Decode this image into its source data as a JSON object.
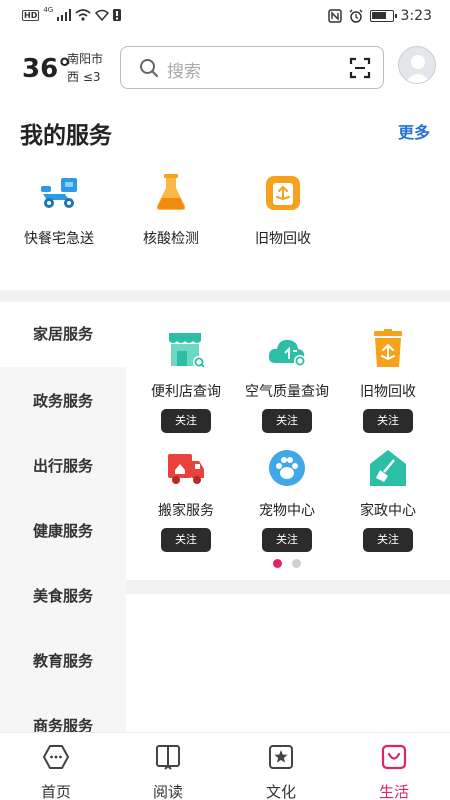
{
  "status_bar": {
    "network": "HD",
    "signal_type": "4G",
    "time": "3:23"
  },
  "header": {
    "temperature": "36°",
    "city": "南阳市",
    "wind": "西 ≤3",
    "search_placeholder": "搜索"
  },
  "my_services": {
    "title": "我的服务",
    "more": "更多",
    "items": [
      {
        "label": "快餐宅急送",
        "icon": "delivery-scooter-icon"
      },
      {
        "label": "核酸检测",
        "icon": "test-tube-icon"
      },
      {
        "label": "旧物回收",
        "icon": "recycle-bin-icon"
      }
    ]
  },
  "categories": [
    {
      "label": "家居服务",
      "active": true
    },
    {
      "label": "政务服务"
    },
    {
      "label": "出行服务"
    },
    {
      "label": "健康服务"
    },
    {
      "label": "美食服务"
    },
    {
      "label": "教育服务"
    },
    {
      "label": "商务服务"
    }
  ],
  "grid": {
    "follow_label": "关注",
    "items": [
      {
        "label": "便利店查询",
        "icon": "store-icon"
      },
      {
        "label": "空气质量查询",
        "icon": "air-cloud-icon"
      },
      {
        "label": "旧物回收",
        "icon": "recycle-bin-icon"
      },
      {
        "label": "搬家服务",
        "icon": "moving-truck-icon"
      },
      {
        "label": "宠物中心",
        "icon": "paw-icon"
      },
      {
        "label": "家政中心",
        "icon": "cleaning-house-icon"
      }
    ],
    "page_count": 2,
    "current_page": 1
  },
  "tabs": [
    {
      "label": "首页",
      "icon": "home-icon"
    },
    {
      "label": "阅读",
      "icon": "book-icon"
    },
    {
      "label": "文化",
      "icon": "culture-icon"
    },
    {
      "label": "生活",
      "icon": "life-icon",
      "active": true
    }
  ],
  "colors": {
    "accent": "#e0245e",
    "link": "#2a6fd6",
    "teal": "#2bbfa5",
    "orange": "#f7a21c",
    "red": "#e8423b",
    "blue": "#3ea8e8"
  }
}
